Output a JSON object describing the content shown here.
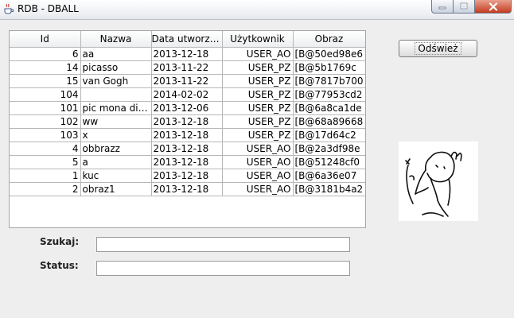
{
  "window": {
    "title": "RDB - DBALL"
  },
  "table": {
    "columns": [
      "Id",
      "Nazwa",
      "Data utworzen...",
      "Użytkownik",
      "Obraz"
    ],
    "rows": [
      [
        "6",
        "aa",
        "2013-12-18",
        "USER_AO",
        "[B@50ed98e6"
      ],
      [
        "14",
        "picasso",
        "2013-11-22",
        "USER_PZ",
        "[B@5b1769c"
      ],
      [
        "15",
        "van Gogh",
        "2013-11-22",
        "USER_PZ",
        "[B@7817b700"
      ],
      [
        "104",
        "",
        "2014-02-02",
        "USER_PZ",
        "[B@77953cd2"
      ],
      [
        "101",
        "pic mona dies...",
        "2013-12-06",
        "USER_PZ",
        "[B@6a8ca1de"
      ],
      [
        "102",
        "ww",
        "2013-12-18",
        "USER_PZ",
        "[B@68a89668"
      ],
      [
        "103",
        "x",
        "2013-12-18",
        "USER_PZ",
        "[B@17d64c2"
      ],
      [
        "4",
        "obbrazz",
        "2013-12-18",
        "USER_AO",
        "[B@2a3df98e"
      ],
      [
        "5",
        "a",
        "2013-12-18",
        "USER_AO",
        "[B@51248cf0"
      ],
      [
        "1",
        "kuc",
        "2013-12-18",
        "USER_AO",
        "[B@6a36e07"
      ],
      [
        "2",
        "obraz1",
        "2013-12-18",
        "USER_AO",
        "[B@3181b4a2"
      ]
    ]
  },
  "toolbar": {
    "refresh_label": "Odśwież"
  },
  "form": {
    "search_label": "Szukaj:",
    "search_value": "",
    "status_label": "Status:",
    "status_value": ""
  },
  "icons": {
    "app": "java-cup-icon",
    "minimize": "minimize-icon",
    "maximize": "maximize-icon",
    "close": "close-icon"
  },
  "colors": {
    "close_button": "#c43b1f",
    "window_bg": "#eeeeee"
  }
}
